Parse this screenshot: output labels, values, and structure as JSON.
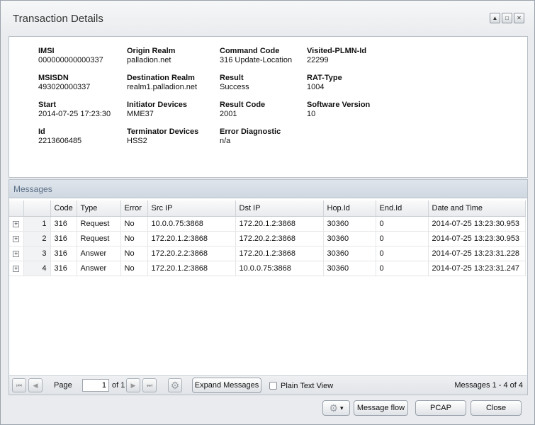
{
  "window": {
    "title": "Transaction Details",
    "controls": {
      "minimize": "▲",
      "maximize": "□",
      "close": "✕"
    }
  },
  "details": {
    "imsi": {
      "label": "IMSI",
      "value": "000000000000337"
    },
    "origin_realm": {
      "label": "Origin Realm",
      "value": "palladion.net"
    },
    "command_code": {
      "label": "Command Code",
      "value": "316 Update-Location"
    },
    "visited_plmn": {
      "label": "Visited-PLMN-Id",
      "value": "22299"
    },
    "msisdn": {
      "label": "MSISDN",
      "value": "493020000337"
    },
    "destination_realm": {
      "label": "Destination Realm",
      "value": "realm1.palladion.net"
    },
    "result": {
      "label": "Result",
      "value": "Success"
    },
    "rat_type": {
      "label": "RAT-Type",
      "value": "1004"
    },
    "start": {
      "label": "Start",
      "value": "2014-07-25 17:23:30"
    },
    "initiator_devices": {
      "label": "Initiator Devices",
      "value": "MME37"
    },
    "result_code": {
      "label": "Result Code",
      "value": "2001"
    },
    "software_version": {
      "label": "Software Version",
      "value": "10"
    },
    "id": {
      "label": "Id",
      "value": "2213606485"
    },
    "terminator_devices": {
      "label": "Terminator Devices",
      "value": "HSS2"
    },
    "error_diagnostic": {
      "label": "Error Diagnostic",
      "value": "n/a"
    }
  },
  "messages": {
    "title": "Messages",
    "columns": [
      "",
      "",
      "Code",
      "Type",
      "Error",
      "Src IP",
      "Dst IP",
      "Hop.Id",
      "End.Id",
      "Date and Time"
    ],
    "rows": [
      {
        "expand": "+",
        "num": "1",
        "code": "316",
        "type": "Request",
        "error": "No",
        "src_ip": "10.0.0.75:3868",
        "dst_ip": "172.20.1.2:3868",
        "hop_id": "30360",
        "end_id": "0",
        "datetime": "2014-07-25 13:23:30.953"
      },
      {
        "expand": "+",
        "num": "2",
        "code": "316",
        "type": "Request",
        "error": "No",
        "src_ip": "172.20.1.2:3868",
        "dst_ip": "172.20.2.2:3868",
        "hop_id": "30360",
        "end_id": "0",
        "datetime": "2014-07-25 13:23:30.953"
      },
      {
        "expand": "+",
        "num": "3",
        "code": "316",
        "type": "Answer",
        "error": "No",
        "src_ip": "172.20.2.2:3868",
        "dst_ip": "172.20.1.2:3868",
        "hop_id": "30360",
        "end_id": "0",
        "datetime": "2014-07-25 13:23:31.228"
      },
      {
        "expand": "+",
        "num": "4",
        "code": "316",
        "type": "Answer",
        "error": "No",
        "src_ip": "172.20.1.2:3868",
        "dst_ip": "10.0.0.75:3868",
        "hop_id": "30360",
        "end_id": "0",
        "datetime": "2014-07-25 13:23:31.247"
      }
    ]
  },
  "pager": {
    "first_icon": "⏮",
    "prev_icon": "◀",
    "next_icon": "▶",
    "last_icon": "⏭",
    "refresh_icon": "⚙",
    "page_label": "Page",
    "page_value": "1",
    "of_label": "of 1",
    "expand_messages": "Expand Messages",
    "plain_text_view": "Plain Text View",
    "summary": "Messages 1 - 4 of 4"
  },
  "footer": {
    "gear_icon": "⚙",
    "dropdown_icon": "▾",
    "message_flow": "Message flow",
    "pcap": "PCAP",
    "close": "Close"
  }
}
